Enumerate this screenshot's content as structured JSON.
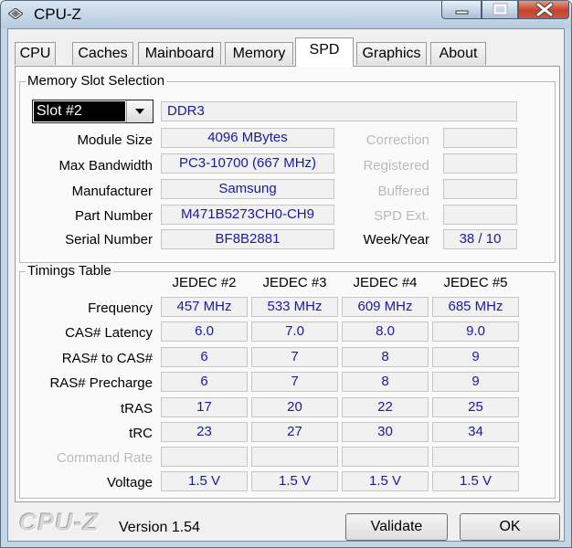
{
  "window": {
    "title": "CPU-Z"
  },
  "tabs": [
    "CPU",
    "Caches",
    "Mainboard",
    "Memory",
    "SPD",
    "Graphics",
    "About"
  ],
  "active_tab": "SPD",
  "slot_section": {
    "title": "Memory Slot Selection",
    "slot_selected": "Slot #2",
    "memory_type": "DDR3",
    "fields": {
      "module_size": {
        "label": "Module Size",
        "value": "4096 MBytes"
      },
      "max_bandwidth": {
        "label": "Max Bandwidth",
        "value": "PC3-10700 (667 MHz)"
      },
      "manufacturer": {
        "label": "Manufacturer",
        "value": "Samsung"
      },
      "part_number": {
        "label": "Part Number",
        "value": "M471B5273CH0-CH9"
      },
      "serial_number": {
        "label": "Serial Number",
        "value": "BF8B2881"
      }
    },
    "right_labels": {
      "correction": "Correction",
      "registered": "Registered",
      "buffered": "Buffered",
      "spd_ext": "SPD Ext.",
      "week_year": "Week/Year"
    },
    "week_year_value": "38 / 10"
  },
  "timings": {
    "title": "Timings Table",
    "columns": [
      "JEDEC #2",
      "JEDEC #3",
      "JEDEC #4",
      "JEDEC #5"
    ],
    "rows": [
      {
        "label": "Frequency",
        "values": [
          "457 MHz",
          "533 MHz",
          "609 MHz",
          "685 MHz"
        ]
      },
      {
        "label": "CAS# Latency",
        "values": [
          "6.0",
          "7.0",
          "8.0",
          "9.0"
        ]
      },
      {
        "label": "RAS# to CAS#",
        "values": [
          "6",
          "7",
          "8",
          "9"
        ]
      },
      {
        "label": "RAS# Precharge",
        "values": [
          "6",
          "7",
          "8",
          "9"
        ]
      },
      {
        "label": "tRAS",
        "values": [
          "17",
          "20",
          "22",
          "25"
        ]
      },
      {
        "label": "tRC",
        "values": [
          "23",
          "27",
          "30",
          "34"
        ]
      },
      {
        "label": "Command Rate",
        "values": [
          "",
          "",
          "",
          ""
        ]
      },
      {
        "label": "Voltage",
        "values": [
          "1.5 V",
          "1.5 V",
          "1.5 V",
          "1.5 V"
        ]
      }
    ]
  },
  "footer": {
    "logo": "CPU-Z",
    "version": "Version 1.54",
    "validate_label": "Validate",
    "ok_label": "OK"
  },
  "colors": {
    "value_text": "#1a1aa0",
    "disabled_text": "#b9b9b9"
  }
}
